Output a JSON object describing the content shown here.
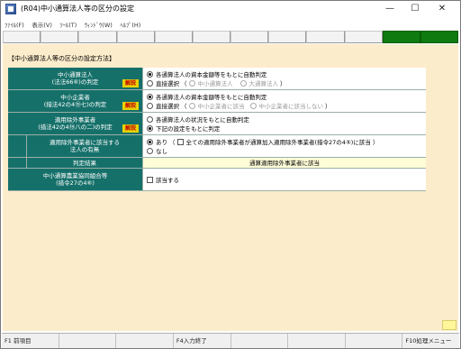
{
  "window": {
    "title": "(R04)中小通算法人等の区分の設定",
    "controls": {
      "minimize": "—",
      "maximize": "☐",
      "close": "✕"
    }
  },
  "menu": [
    "ﾌｧｲﾙ(F)",
    "表示(V)",
    "ﾂｰﾙ(T)",
    "ｳｨﾝﾄﾞｳ(W)",
    "ﾍﾙﾌﾟ(H)"
  ],
  "toolbar": {
    "button_count": 12,
    "active_color": "#0f7a0f"
  },
  "section": {
    "title": "【中小通算法人等の区分の設定方法】"
  },
  "rows": {
    "r1": {
      "label_line1": "中小通算法人",
      "label_line2": "(法法66⑥)の判定",
      "kaisetsu": "解説",
      "opt1": "各通算法人の資本金額等をもとに自動判定",
      "opt2_prefix": "直接選択",
      "opt2_a": "中小通算法人",
      "opt2_b": "大通算法人"
    },
    "r2": {
      "label_line1": "中小企業者",
      "label_line2": "(措法42の4⑲七)の判定",
      "kaisetsu": "解説",
      "opt1": "各通算法人の資本金額等をもとに自動判定",
      "opt2_prefix": "直接選択",
      "opt2_a": "中小企業者に該当",
      "opt2_b": "中小企業者に該当しない"
    },
    "r3": {
      "label_line1": "適用除外事業者",
      "label_line2": "(措法42の4⑲八の二)の判定",
      "kaisetsu": "解説",
      "opt1": "各通算法人の状況をもとに自動判定",
      "opt2": "下記の設定をもとに判定"
    },
    "r4": {
      "label_line1": "適用除外事業者に該当する",
      "label_line2": "法人の有無",
      "opt1": "あり",
      "opt1_note": "全ての適用除外事業者が通算加入適用除外事業者(措令27の4⑤)に該当",
      "opt2": "なし"
    },
    "r5": {
      "label": "判定結果",
      "value": "通算適用除外事業者に該当"
    },
    "r6": {
      "label_line1": "中小通算農業協同組合等",
      "label_line2": "(措令27の4⑥)",
      "check_label": "該当する"
    }
  },
  "fkeys": [
    "F1 前項目",
    "",
    "",
    "",
    "F4入力終了",
    "",
    "",
    "",
    "",
    "F10処理メニュー"
  ]
}
